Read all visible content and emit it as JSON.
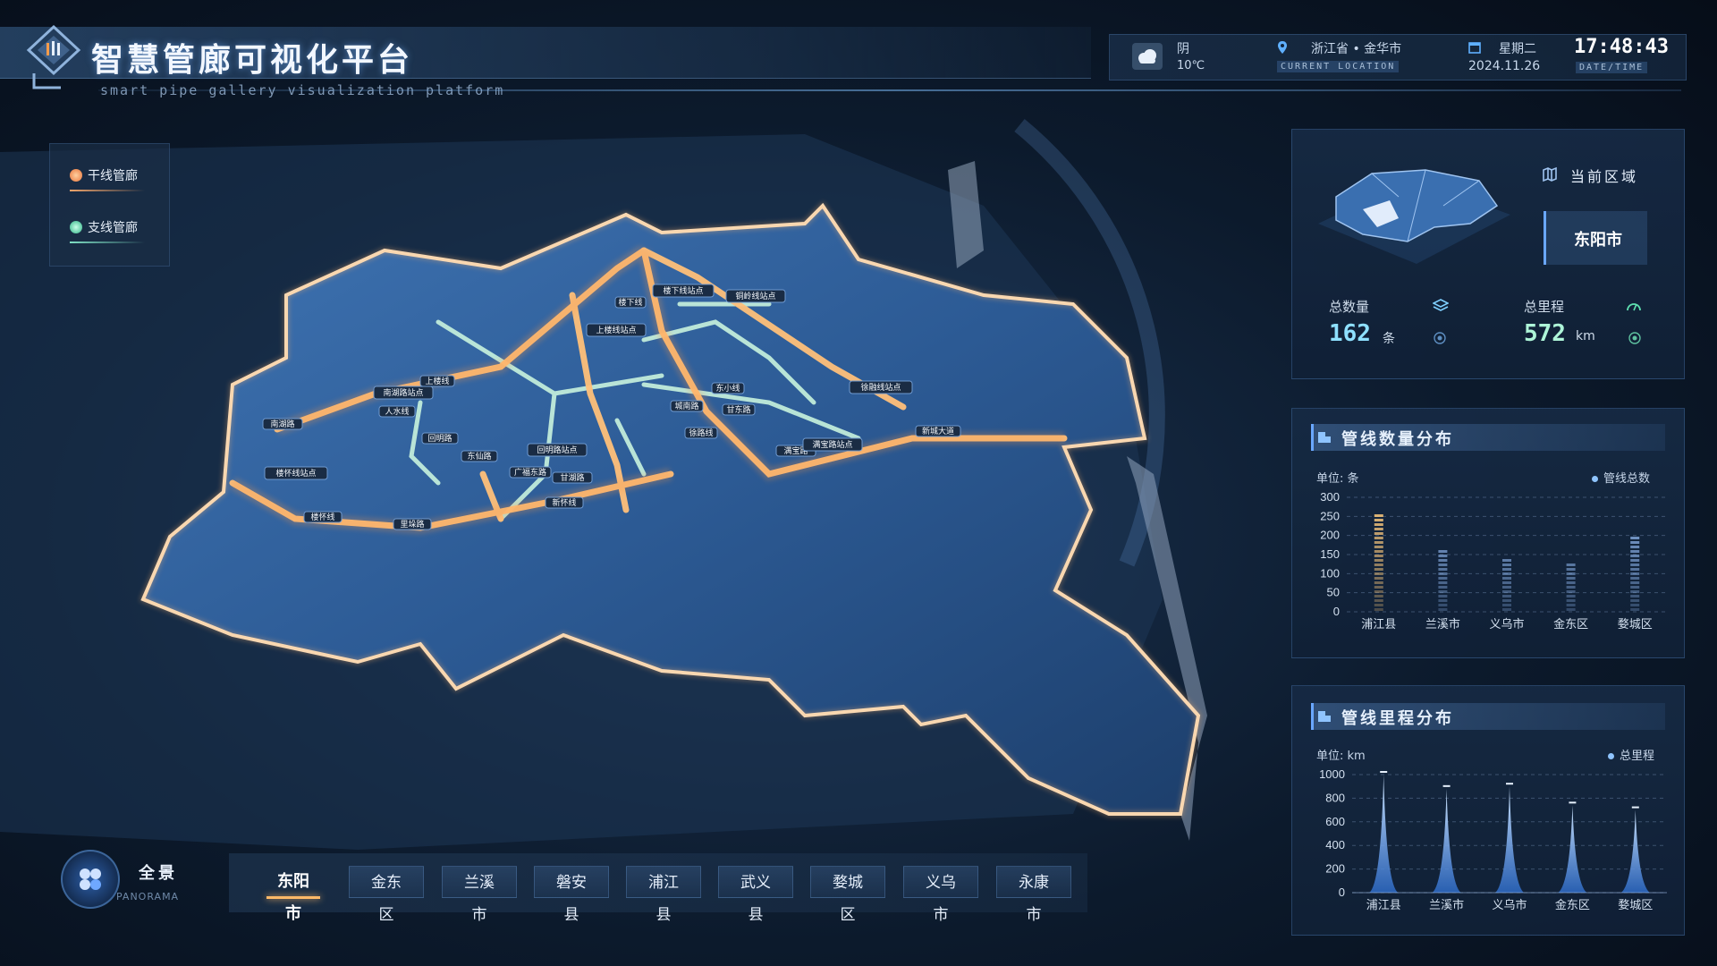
{
  "header": {
    "title": "智慧管廊可视化平台",
    "subtitle": "smart pipe gallery visualization platform"
  },
  "info": {
    "weather_icon": "cloudy-icon",
    "weather": "阴",
    "temperature": "10℃",
    "location": "浙江省 • 金华市",
    "location_tag": "CURRENT LOCATION",
    "weekday": "星期二",
    "date": "2024.11.26",
    "time": "17:48:43",
    "datetime_tag": "DATE/TIME"
  },
  "legend": {
    "items": [
      {
        "label": "干线管廊",
        "color": "#f0a46a"
      },
      {
        "label": "支线管廊",
        "color": "#7fe0c4"
      }
    ]
  },
  "map": {
    "station_labels": [
      "楼下线站点",
      "楼下线",
      "铜岭线站点",
      "上楼线站点",
      "上楼线",
      "南湖路站点",
      "人水线",
      "南湖路",
      "回明路",
      "楼怀线站点",
      "东仙路",
      "回明路站点",
      "广福东路",
      "甘湖路",
      "新怀线",
      "楼怀线",
      "里垛路",
      "城南路",
      "东小线",
      "甘东路",
      "徐路线",
      "徐融线站点",
      "新城大道",
      "满宝路",
      "满宝路站点"
    ]
  },
  "region_panel": {
    "current_region_label": "当前区域",
    "current_region": "东阳市",
    "total_count_label": "总数量",
    "total_count": "162",
    "total_count_unit": "条",
    "total_length_label": "总里程",
    "total_length": "572",
    "total_length_unit": "km"
  },
  "count_panel": {
    "title": "管线数量分布",
    "unit_label": "单位: 条",
    "legend": "管线总数"
  },
  "length_panel": {
    "title": "管线里程分布",
    "unit_label": "单位: km",
    "legend": "总里程"
  },
  "chart_data": [
    {
      "type": "bar",
      "title": "管线数量分布",
      "categories": [
        "浦江县",
        "兰溪市",
        "义乌市",
        "金东区",
        "婺城区"
      ],
      "series": [
        {
          "name": "管线总数",
          "values": [
            260,
            170,
            145,
            135,
            205
          ]
        }
      ],
      "ylabel": "单位: 条",
      "ylim": [
        0,
        300
      ],
      "yticks": [
        0,
        50,
        100,
        150,
        200,
        250,
        300
      ],
      "grid": true,
      "legend": "top-right",
      "colors": {
        "highlight": "#f2c27a",
        "normal": "#8fb6ee"
      }
    },
    {
      "type": "area",
      "title": "管线里程分布",
      "categories": [
        "浦江县",
        "兰溪市",
        "义乌市",
        "金东区",
        "婺城区"
      ],
      "series": [
        {
          "name": "总里程",
          "values": [
            1000,
            880,
            900,
            740,
            700
          ]
        }
      ],
      "ylabel": "单位: km",
      "ylim": [
        0,
        1000
      ],
      "yticks": [
        0,
        200,
        400,
        600,
        800,
        1000
      ],
      "grid": true,
      "legend": "top-right",
      "colors": {
        "spike": "#8fc4ff"
      }
    }
  ],
  "bottom_nav": {
    "panorama_icon": "panorama-icon",
    "panorama_label": "全景",
    "panorama_sub": "PANORAMA",
    "districts": [
      "东阳市",
      "金东区",
      "兰溪市",
      "磐安县",
      "浦江县",
      "武义县",
      "婺城区",
      "义乌市",
      "永康市"
    ],
    "active": "东阳市"
  }
}
